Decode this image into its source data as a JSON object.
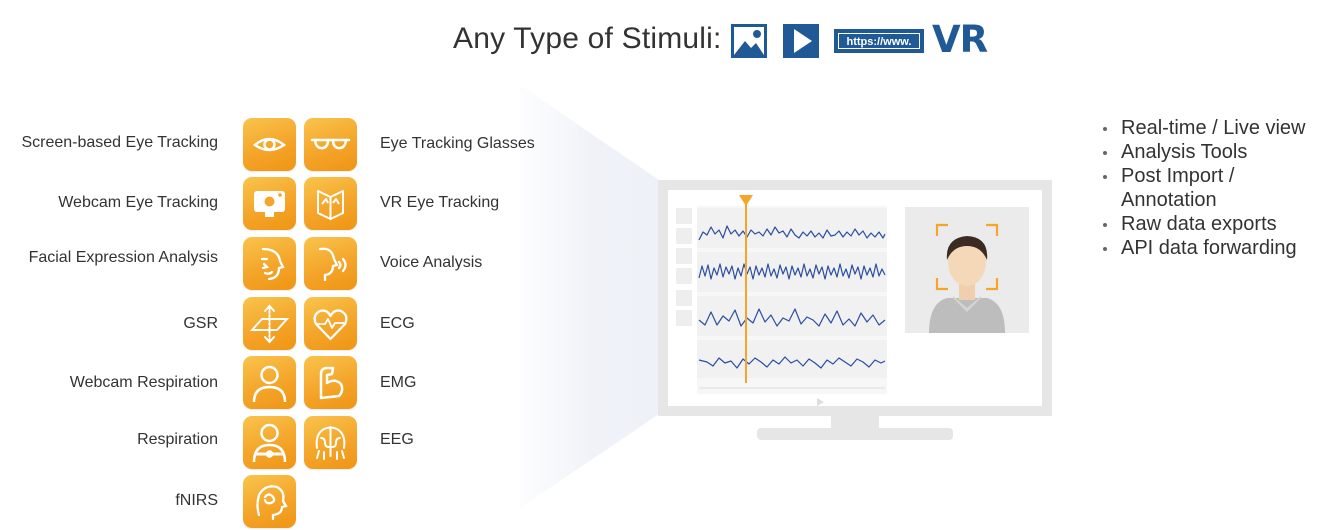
{
  "header": {
    "title": "Any Type of Stimuli:",
    "stimuli": [
      {
        "name": "image",
        "icon": "image-icon"
      },
      {
        "name": "video",
        "icon": "play-icon"
      },
      {
        "name": "website",
        "icon": "url-icon",
        "label": "https://www."
      },
      {
        "name": "vr",
        "icon": "vr-icon",
        "label": "VR"
      }
    ]
  },
  "sensors": {
    "left": [
      {
        "label": "Screen-based Eye Tracking",
        "icon": "eye-icon"
      },
      {
        "label": "Webcam Eye Tracking",
        "icon": "webcam-icon"
      },
      {
        "label": "Facial Expression Analysis",
        "icon": "face-icon"
      },
      {
        "label": "GSR",
        "icon": "gsr-icon"
      },
      {
        "label": "Webcam Respiration",
        "icon": "person-icon"
      },
      {
        "label": "Respiration",
        "icon": "respiration-belt-icon"
      },
      {
        "label": "fNIRS",
        "icon": "brain-head-icon"
      }
    ],
    "right": [
      {
        "label": "Eye Tracking Glasses",
        "icon": "glasses-icon"
      },
      {
        "label": "VR Eye Tracking",
        "icon": "vr-headset-icon"
      },
      {
        "label": "Voice Analysis",
        "icon": "voice-icon"
      },
      {
        "label": "ECG",
        "icon": "heart-icon"
      },
      {
        "label": "EMG",
        "icon": "arm-muscle-icon"
      },
      {
        "label": "EEG",
        "icon": "eeg-icon"
      }
    ]
  },
  "monitor": {
    "screen_icon": "monitor-icon",
    "avatar_icon": "person-avatar-icon",
    "marker_icon": "timeline-marker-icon",
    "play_icon": "play-small-icon"
  },
  "features": [
    {
      "line1": "Real-time / Live view"
    },
    {
      "line1": "Analysis Tools"
    },
    {
      "line1": "Post Import /",
      "line2": "Annotation"
    },
    {
      "line1": "Raw data exports"
    },
    {
      "line1": "API data forwarding"
    }
  ],
  "colors": {
    "accent": "#f4a52a",
    "brand_blue": "#1f5a96",
    "signal_blue": "#2a4fa0",
    "monitor_gray": "#e6e6e6"
  }
}
